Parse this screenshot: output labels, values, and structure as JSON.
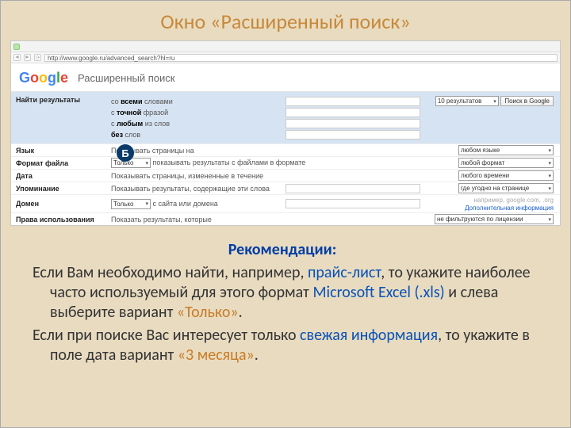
{
  "slide_title": "Окно «Расширенный поиск»",
  "url": "http://www.google.ru/advanced_search?hl=ru",
  "logo": {
    "g1": "G",
    "o1": "o",
    "o2": "o",
    "g2": "g",
    "l": "l",
    "e": "e"
  },
  "page_heading": "Расширенный поиск",
  "top_controls": {
    "results_label": "10 результатов",
    "search_btn": "Поиск в Google"
  },
  "find": {
    "heading": "Найти результаты",
    "row_all": {
      "pre": "со ",
      "bold": "всеми",
      "post": " словами"
    },
    "row_phrase": {
      "pre": "с ",
      "bold": "точной",
      "post": " фразой"
    },
    "row_any": {
      "pre": "с ",
      "bold": "любым",
      "post": " из слов"
    },
    "row_without": {
      "pre": "",
      "bold": "без",
      "post": " слов"
    }
  },
  "rows": {
    "lang": {
      "label": "Язык",
      "desc": "Показывать страницы на",
      "sel": "любом языке"
    },
    "format": {
      "label": "Формат файла",
      "only": "Только",
      "desc": "показывать результаты с файлами в формате",
      "sel": "любой формат"
    },
    "date": {
      "label": "Дата",
      "desc": "Показывать страницы, измененные в течение",
      "sel": "любого времени"
    },
    "mention": {
      "label": "Упоминание",
      "desc": "Показывать результаты, содержащие эти слова",
      "sel": "где угодно на странице"
    },
    "domain": {
      "label": "Домен",
      "only": "Только",
      "desc": "с сайта или домена",
      "hint": "например, google.com, .org",
      "extra": "Дополнительная информация"
    },
    "rights": {
      "label": "Права использования",
      "desc": "Показать результаты, которые",
      "sel": "не фильтруются по лицензии"
    }
  },
  "marker": "Б",
  "rec": {
    "title": "Рекомендации:",
    "p1_a": "Если Вам необходимо найти, например, ",
    "p1_hl1": "прайс-лист",
    "p1_b": ", то укажите наиболее часто используемый для этого формат ",
    "p1_hl2": "Microsoft Excel (.xls)",
    "p1_c": " и слева выберите вариант ",
    "p1_hl3": "«Только»",
    "p1_d": ".",
    "p2_a": "Если при поиске Вас интересует только ",
    "p2_hl1": "свежая информация",
    "p2_b": ", то укажите в поле дата вариант ",
    "p2_hl2": "«3 месяца»",
    "p2_c": "."
  }
}
